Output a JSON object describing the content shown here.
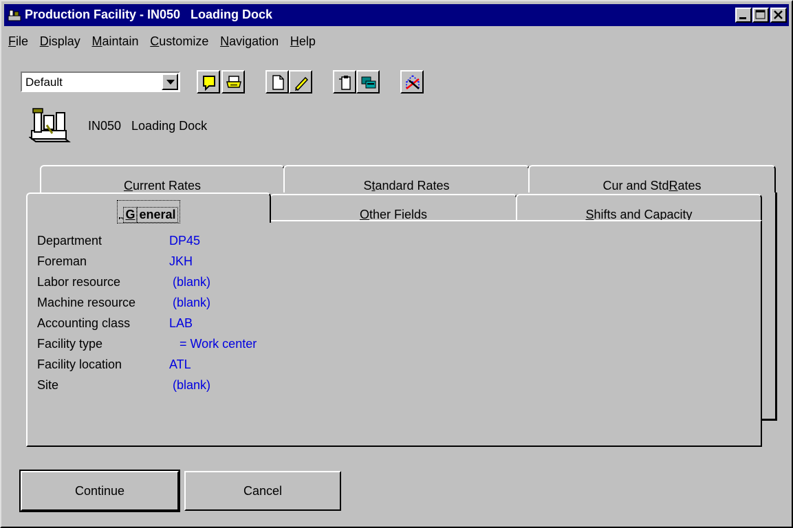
{
  "window": {
    "title": "Production Facility - IN050   Loading Dock",
    "buttons": [
      "minimize",
      "maximize",
      "close"
    ]
  },
  "menu": [
    {
      "label": "File",
      "u": "F",
      "rest": "ile"
    },
    {
      "label": "Display",
      "u": "D",
      "rest": "isplay"
    },
    {
      "label": "Maintain",
      "u": "M",
      "rest": "aintain"
    },
    {
      "label": "Customize",
      "u": "C",
      "rest": "ustomize"
    },
    {
      "label": "Navigation",
      "u": "N",
      "rest": "avigation"
    },
    {
      "label": "Help",
      "u": "H",
      "rest": "elp"
    }
  ],
  "toolbar": {
    "view_select": "Default",
    "tools": [
      "note-icon",
      "print-icon",
      "new-document-icon",
      "edit-pencil-icon",
      "clipboard-icon",
      "windows-icon",
      "network-icon"
    ]
  },
  "record": {
    "label": "IN050   Loading Dock"
  },
  "tabs_back": [
    {
      "pre": "",
      "u": "C",
      "post": "urrent Rates"
    },
    {
      "pre": "S",
      "u": "t",
      "post": "andard Rates"
    },
    {
      "pre": "Cur and Std ",
      "u": "R",
      "post": "ates"
    }
  ],
  "tabs_front": [
    {
      "pre": "",
      "u": "G",
      "post": "eneral"
    },
    {
      "pre": "",
      "u": "O",
      "post": "ther Fields"
    },
    {
      "pre": "",
      "u": "S",
      "post": "hifts and Capacity"
    }
  ],
  "fields": [
    {
      "label": "Department",
      "value": "DP45"
    },
    {
      "label": "Foreman",
      "value": "JKH"
    },
    {
      "label": "Labor resource",
      "value": " (blank)"
    },
    {
      "label": "Machine resource",
      "value": " (blank)"
    },
    {
      "label": "Accounting class",
      "value": "LAB"
    },
    {
      "label": "Facility type",
      "value": "   = Work center"
    },
    {
      "label": "Facility location",
      "value": "ATL"
    },
    {
      "label": "Site",
      "value": " (blank)"
    }
  ],
  "buttons": {
    "continue": "Continue",
    "cancel": "Cancel"
  }
}
